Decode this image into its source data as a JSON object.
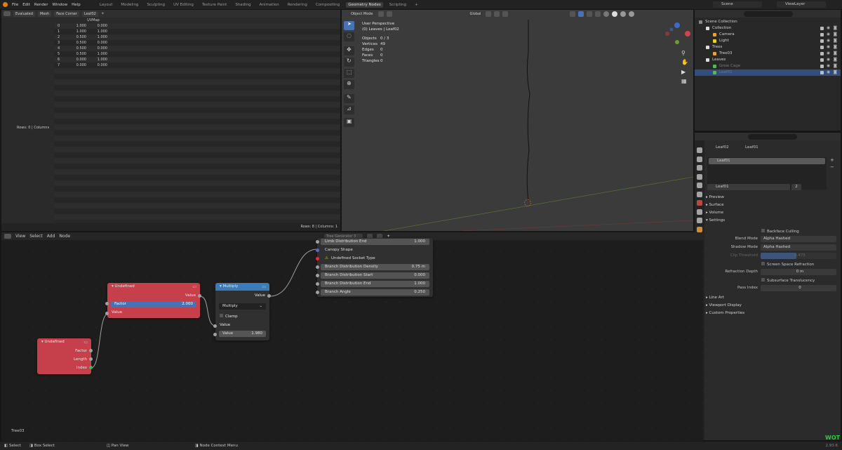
{
  "topbar": {
    "menus": [
      "File",
      "Edit",
      "Render",
      "Window",
      "Help"
    ],
    "workspaces": [
      "Layout",
      "Modeling",
      "Sculpting",
      "UV Editing",
      "Texture Paint",
      "Shading",
      "Animation",
      "Rendering",
      "Compositing",
      "Geometry Nodes",
      "Scripting"
    ],
    "active_workspace": "Geometry Nodes",
    "add_tab": "+",
    "scene": "Scene",
    "view_layer": "ViewLayer"
  },
  "spreadsheet": {
    "mode": "Evaluated",
    "component": "Mesh",
    "domain": "Face Corner",
    "object": "Leaf02",
    "column_header": "UVMap",
    "rows": [
      {
        "index": "0",
        "u": "1.000",
        "v": "0.000"
      },
      {
        "index": "1",
        "u": "1.000",
        "v": "1.000"
      },
      {
        "index": "2",
        "u": "0.500",
        "v": "1.000"
      },
      {
        "index": "3",
        "u": "0.500",
        "v": "0.000"
      },
      {
        "index": "4",
        "u": "0.500",
        "v": "0.000"
      },
      {
        "index": "5",
        "u": "0.500",
        "v": "1.000"
      },
      {
        "index": "6",
        "u": "0.000",
        "v": "1.000"
      },
      {
        "index": "7",
        "u": "0.000",
        "v": "0.000"
      }
    ],
    "left_status": "Rows: 0   |   Columns",
    "footer": "Rows: 8   |   Columns: 1"
  },
  "viewport": {
    "mode": "Object Mode",
    "transform": "Global",
    "title": "User Perspective",
    "subtitle": "(0) Leaves | Leaf02",
    "stats": [
      {
        "label": "Objects",
        "value": "0 / 3"
      },
      {
        "label": "Vertices",
        "value": "49"
      },
      {
        "label": "Edges",
        "value": "0"
      },
      {
        "label": "Faces",
        "value": "0"
      },
      {
        "label": "Triangles",
        "value": "0"
      }
    ]
  },
  "outliner": {
    "rows": [
      {
        "label": "Scene Collection",
        "indent": 0,
        "selected": false,
        "muted": false
      },
      {
        "label": "Collection",
        "indent": 1,
        "selected": false,
        "muted": false
      },
      {
        "label": "Camera",
        "indent": 2,
        "selected": false,
        "muted": false
      },
      {
        "label": "Light",
        "indent": 2,
        "selected": false,
        "muted": false
      },
      {
        "label": "Trees",
        "indent": 1,
        "selected": false,
        "muted": false
      },
      {
        "label": "Tree03",
        "indent": 2,
        "selected": false,
        "muted": false
      },
      {
        "label": "Leaves",
        "indent": 1,
        "selected": false,
        "muted": false
      },
      {
        "label": "Grow Cage",
        "indent": 2,
        "selected": false,
        "muted": true
      },
      {
        "label": "Leaf01",
        "indent": 2,
        "selected": true,
        "muted": true
      }
    ]
  },
  "properties": {
    "object": "Leaf02",
    "material_tab": "Leaf01",
    "slot": "Leaf01",
    "material": "Leaf01",
    "users": "2",
    "sections": [
      "Preview",
      "Surface",
      "Volume",
      "Settings"
    ],
    "backface_culling": "Backface Culling",
    "blend_mode_label": "Blend Mode",
    "blend_mode": "Alpha Hashed",
    "shadow_mode_label": "Shadow Mode",
    "shadow_mode": "Alpha Hashed",
    "clip_label": "Clip Threshold",
    "clip_value": "0.475",
    "ssr": "Screen Space Refraction",
    "refraction_label": "Refraction Depth",
    "refraction_value": "0 m",
    "sss": "Subsurface Translucency",
    "pass_label": "Pass Index",
    "pass_value": "0",
    "more_sections": [
      "Line Art",
      "Viewport Display",
      "Custom Properties"
    ]
  },
  "node_editor": {
    "menus": [
      "View",
      "Select",
      "Add",
      "Node"
    ],
    "tree_name": "Tree Generator 3",
    "footer_label": "Tree03",
    "logo": "WOT",
    "version": "2.93.6",
    "node_undef_a": {
      "title": "Undefined",
      "out_value": "Value",
      "factor_label": "Factor",
      "factor_value": "2.000",
      "in_value": "Value"
    },
    "node_undef_b": {
      "title": "Undefined",
      "factor": "Factor",
      "length": "Length",
      "index": "Index"
    },
    "node_multiply": {
      "title": "Multiply",
      "out_value": "Value",
      "operation": "Multiply",
      "clamp": "Clamp",
      "in_value": "Value",
      "value_label": "Value",
      "value": "1.980"
    },
    "node_group": {
      "rows": [
        {
          "label": "Limb Distribution End",
          "value": "1.000"
        },
        {
          "label": "Canopy Shape",
          "value": ""
        },
        {
          "label": "Undefined Socket Type",
          "value": ""
        },
        {
          "label": "Branch Distribution Density",
          "value": "0.75 m"
        },
        {
          "label": "Branch Distribution Start",
          "value": "0.000"
        },
        {
          "label": "Branch Distribution End",
          "value": "1.000"
        },
        {
          "label": "Branch Angle",
          "value": "0.250"
        }
      ]
    }
  },
  "statusbar": {
    "items": [
      "Select",
      "Box Select",
      "Pan View",
      "Node Context Menu"
    ]
  },
  "colors": {
    "accent": "#4772b3",
    "node_red": "#c5404a",
    "node_blue": "#3a7bb8"
  }
}
